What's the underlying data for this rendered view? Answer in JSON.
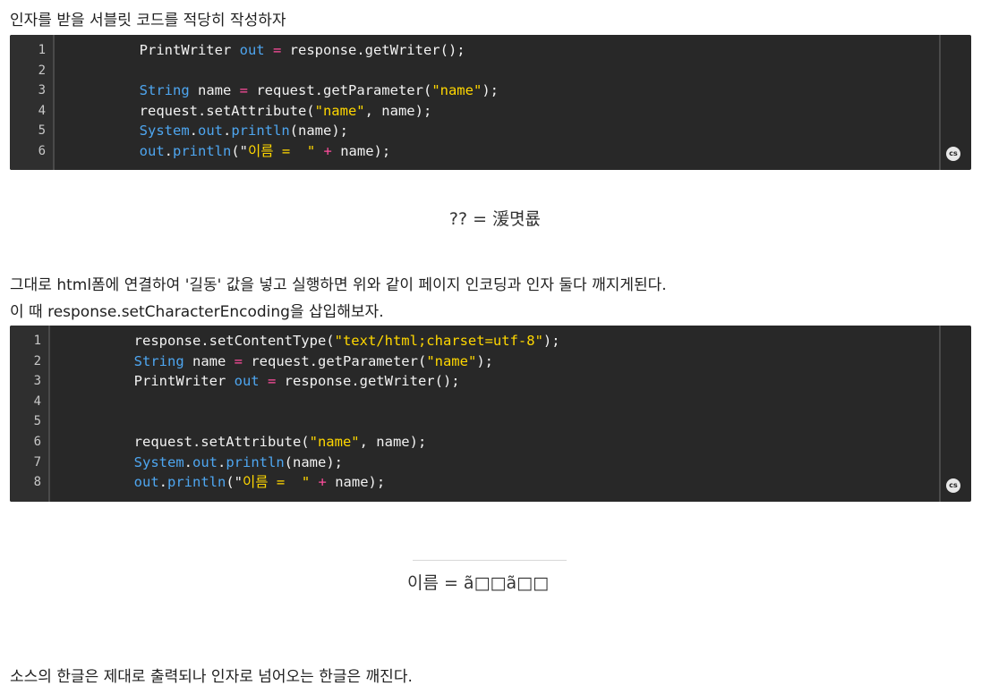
{
  "intro_text": "인자를 받을 서블릿 코드를 적당히 작성하자",
  "code1": {
    "badge": "cs",
    "lines": [
      [
        {
          "t": "        PrintWriter "
        },
        {
          "t": "out",
          "c": "kw"
        },
        {
          "t": " "
        },
        {
          "t": "=",
          "c": "op"
        },
        {
          "t": " response.getWriter();"
        }
      ],
      [],
      [
        {
          "t": "        "
        },
        {
          "t": "String",
          "c": "kw"
        },
        {
          "t": " name "
        },
        {
          "t": "=",
          "c": "op"
        },
        {
          "t": " request.getParameter("
        },
        {
          "t": "\"name\"",
          "c": "str"
        },
        {
          "t": ");"
        }
      ],
      [
        {
          "t": "        request.setAttribute("
        },
        {
          "t": "\"name\"",
          "c": "str"
        },
        {
          "t": ", name);"
        }
      ],
      [
        {
          "t": "        "
        },
        {
          "t": "System",
          "c": "kw"
        },
        {
          "t": "."
        },
        {
          "t": "out",
          "c": "kw"
        },
        {
          "t": "."
        },
        {
          "t": "println",
          "c": "kw"
        },
        {
          "t": "(name);"
        }
      ],
      [
        {
          "t": "        "
        },
        {
          "t": "out",
          "c": "kw"
        },
        {
          "t": "."
        },
        {
          "t": "println",
          "c": "kw"
        },
        {
          "t": "(\""
        },
        {
          "t": "이름 =  \"",
          "c": "str"
        },
        {
          "t": " "
        },
        {
          "t": "+",
          "c": "op"
        },
        {
          "t": " name);"
        }
      ]
    ]
  },
  "output1": "?? = 湲몃룞",
  "desc1": "그대로 html폼에 연결하여 '길동' 값을 넣고 실행하면 위와 같이 페이지 인코딩과 인자 둘다 깨지게된다.",
  "desc2": "이 때 response.setCharacterEncoding을 삽입해보자.",
  "code2": {
    "badge": "cs",
    "lines": [
      [
        {
          "t": "        response.setContentType("
        },
        {
          "t": "\"text/html;charset=utf-8\"",
          "c": "str"
        },
        {
          "t": ");"
        }
      ],
      [
        {
          "t": "        "
        },
        {
          "t": "String",
          "c": "kw"
        },
        {
          "t": " name "
        },
        {
          "t": "=",
          "c": "op"
        },
        {
          "t": " request.getParameter("
        },
        {
          "t": "\"name\"",
          "c": "str"
        },
        {
          "t": ");"
        }
      ],
      [
        {
          "t": "        PrintWriter "
        },
        {
          "t": "out",
          "c": "kw"
        },
        {
          "t": " "
        },
        {
          "t": "=",
          "c": "op"
        },
        {
          "t": " response.getWriter();"
        }
      ],
      [],
      [],
      [
        {
          "t": "        request.setAttribute("
        },
        {
          "t": "\"name\"",
          "c": "str"
        },
        {
          "t": ", name);"
        }
      ],
      [
        {
          "t": "        "
        },
        {
          "t": "System",
          "c": "kw"
        },
        {
          "t": "."
        },
        {
          "t": "out",
          "c": "kw"
        },
        {
          "t": "."
        },
        {
          "t": "println",
          "c": "kw"
        },
        {
          "t": "(name);"
        }
      ],
      [
        {
          "t": "        "
        },
        {
          "t": "out",
          "c": "kw"
        },
        {
          "t": "."
        },
        {
          "t": "println",
          "c": "kw"
        },
        {
          "t": "(\""
        },
        {
          "t": "이름 =  \"",
          "c": "str"
        },
        {
          "t": " "
        },
        {
          "t": "+",
          "c": "op"
        },
        {
          "t": " name);"
        }
      ]
    ]
  },
  "output2": "이름 = ã□□ã□□",
  "conclusion": "소스의 한글은 제대로 출력되나 인자로 넘어오는 한글은 깨진다."
}
